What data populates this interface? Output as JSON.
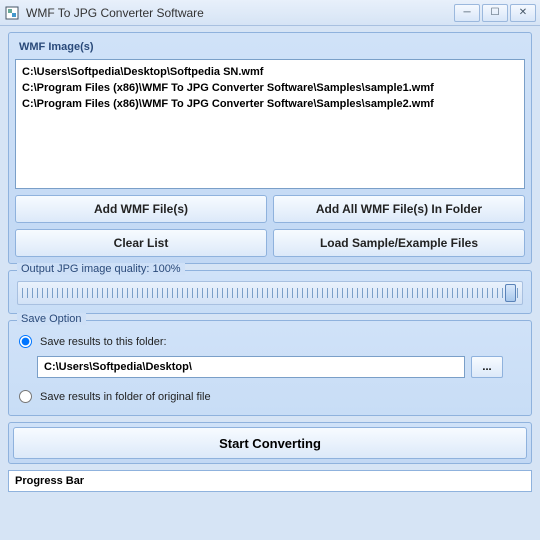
{
  "window": {
    "title": "WMF To JPG Converter Software"
  },
  "file_panel": {
    "header": "WMF Image(s)",
    "files": [
      "C:\\Users\\Softpedia\\Desktop\\Softpedia SN.wmf",
      "C:\\Program Files (x86)\\WMF To JPG Converter Software\\Samples\\sample1.wmf",
      "C:\\Program Files (x86)\\WMF To JPG Converter Software\\Samples\\sample2.wmf"
    ]
  },
  "buttons": {
    "add_files": "Add WMF File(s)",
    "add_folder": "Add All WMF File(s) In Folder",
    "clear": "Clear List",
    "load_sample": "Load Sample/Example Files",
    "start": "Start Converting",
    "browse": "..."
  },
  "quality": {
    "label": "Output JPG image quality: 100%",
    "value": 100
  },
  "save": {
    "legend": "Save Option",
    "opt_folder": "Save results to this folder:",
    "opt_original": "Save results in folder of original file",
    "path": "C:\\Users\\Softpedia\\Desktop\\",
    "selected": "folder"
  },
  "progress": {
    "label": "Progress Bar"
  }
}
